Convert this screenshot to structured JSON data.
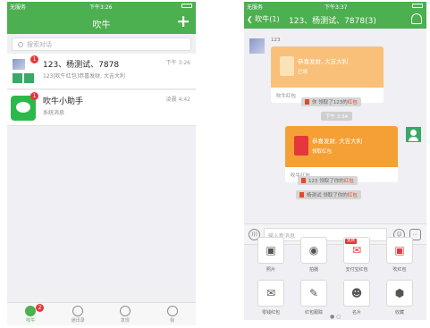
{
  "left": {
    "status": {
      "carrier": "无服务",
      "time": "下午3:26"
    },
    "nav": {
      "title": "吹牛",
      "add": "+"
    },
    "search": {
      "icon": "search-icon",
      "placeholder": "搜索对话"
    },
    "conversations": [
      {
        "name": "123、杨测试、7878",
        "subtitle": "123[吹牛红包]恭喜发财, 大吉大利",
        "time": "下午 3:26",
        "badge": "1"
      },
      {
        "name": "吹牛小助手",
        "subtitle": "系统消息",
        "time": "凌晨 4:42",
        "badge": "1"
      }
    ],
    "tabs": [
      {
        "label": "吹牛",
        "icon": "chat-icon",
        "badge": "2",
        "active": true
      },
      {
        "label": "通讯录",
        "icon": "contacts-icon"
      },
      {
        "label": "发现",
        "icon": "compass-icon"
      },
      {
        "label": "我",
        "icon": "person-icon"
      }
    ]
  },
  "right": {
    "status": {
      "carrier": "无服务",
      "time": "下午3:37"
    },
    "nav": {
      "back": "吹牛(1)",
      "title": "123、杨测试、7878(3)"
    },
    "messages": {
      "sender_name": "123",
      "packet1": {
        "greeting": "恭喜发财, 大吉大利",
        "state": "已领",
        "footer": "吹牛红包"
      },
      "sys1": {
        "prefix": "你 领取了123的",
        "link": "红包"
      },
      "time2": "下午 3:34",
      "packet2": {
        "greeting": "恭喜发财, 大吉大利",
        "state": "领取红包",
        "footer": "吹牛红包"
      },
      "sys2": {
        "prefix": "123 领取了你的",
        "link": "红包"
      },
      "sys3": {
        "prefix": "杨测试 领取了你的",
        "link": "红包"
      }
    },
    "input": {
      "placeholder": "输入新消息"
    },
    "plugins": [
      {
        "label": "照片",
        "icon": "photo-icon"
      },
      {
        "label": "拍摄",
        "icon": "camera-icon"
      },
      {
        "label": "支付宝红包",
        "icon": "alipay-packet-icon",
        "tag": "免费"
      },
      {
        "label": "吹红包",
        "icon": "red-packet-icon"
      },
      {
        "label": "零钱红包",
        "icon": "cash-packet-icon"
      },
      {
        "label": "红包跟踪",
        "icon": "packet-track-icon"
      },
      {
        "label": "名片",
        "icon": "card-icon"
      },
      {
        "label": "收藏",
        "icon": "favorite-icon"
      }
    ],
    "colors": {
      "brand_green": "#4caf50",
      "packet_orange": "#f5a034",
      "packet_orange_light": "#f9c07a",
      "red": "#e5373b"
    }
  }
}
